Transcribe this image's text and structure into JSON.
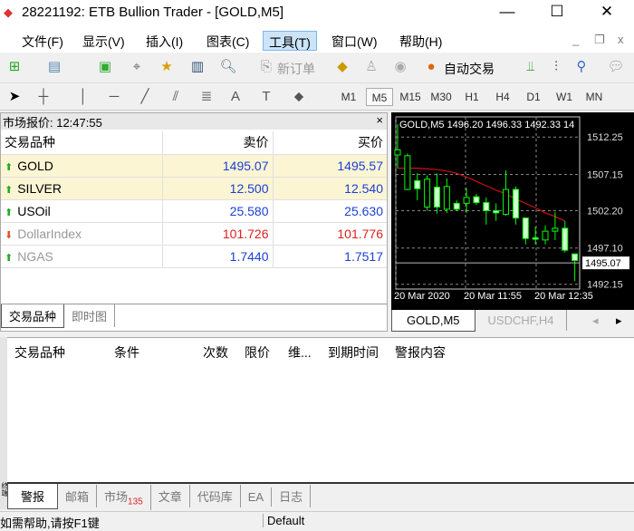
{
  "window": {
    "title": "28221192: ETB Bullion Trader - [GOLD,M5]",
    "minimize": "—",
    "maximize": "☐",
    "close": "✕"
  },
  "menu": [
    "文件(F)",
    "显示(V)",
    "插入(I)",
    "图表(C)",
    "工具(T)",
    "窗口(W)",
    "帮助(H)"
  ],
  "toolbar": {
    "new_order": "新订单",
    "auto_trade": "自动交易"
  },
  "timeframes": [
    "M1",
    "M5",
    "M15",
    "M30",
    "H1",
    "H4",
    "D1",
    "W1",
    "MN"
  ],
  "market_watch": {
    "title": "市场报价: 12:47:55",
    "headers": [
      "交易品种",
      "卖价",
      "买价"
    ],
    "rows": [
      {
        "symbol": "GOLD",
        "bid": "1495.07",
        "ask": "1495.57",
        "dir": "up",
        "color": "#1a3fd6",
        "hl": true
      },
      {
        "symbol": "SILVER",
        "bid": "12.500",
        "ask": "12.540",
        "dir": "up",
        "color": "#1a3fd6",
        "hl": true
      },
      {
        "symbol": "USOil",
        "bid": "25.580",
        "ask": "25.630",
        "dir": "up",
        "color": "#1a3fd6",
        "hl": false
      },
      {
        "symbol": "DollarIndex",
        "bid": "101.726",
        "ask": "101.776",
        "dir": "down",
        "color": "#e02020",
        "hl": false
      },
      {
        "symbol": "NGAS",
        "bid": "1.7440",
        "ask": "1.7517",
        "dir": "up",
        "color": "#1a3fd6",
        "hl": false
      }
    ],
    "tabs": [
      "交易品种",
      "即时图"
    ]
  },
  "chart_data": {
    "type": "candlestick",
    "title": "GOLD,M5  1496.20 1496.33 1492.33 14",
    "y_ticks": [
      "1512.25",
      "1507.15",
      "1502.20",
      "1497.10",
      "1492.15"
    ],
    "ylim": [
      1491.5,
      1515
    ],
    "x_labels": [
      "20 Mar 2020",
      "20 Mar 11:55",
      "20 Mar 12:35"
    ],
    "current_price": "1495.07",
    "ohlc": [
      [
        1509.8,
        1514,
        1508,
        1510.5
      ],
      [
        1505.1,
        1510,
        1505,
        1509.7
      ],
      [
        1506.3,
        1507.3,
        1503.6,
        1505.2
      ],
      [
        1502.7,
        1507,
        1502.2,
        1506.5
      ],
      [
        1505.4,
        1507.3,
        1501.8,
        1502.7
      ],
      [
        1502.4,
        1506.6,
        1501.9,
        1505.5
      ],
      [
        1503.2,
        1503.6,
        1502.2,
        1502.4
      ],
      [
        1503.2,
        1505.3,
        1501.9,
        1504.0
      ],
      [
        1504.1,
        1504.5,
        1503,
        1503.3
      ],
      [
        1503.3,
        1504,
        1500.3,
        1502.2
      ],
      [
        1502.2,
        1503.2,
        1500.8,
        1501.9
      ],
      [
        1501.7,
        1507.7,
        1501.5,
        1505.1
      ],
      [
        1505.1,
        1505.5,
        1500.3,
        1501.2
      ],
      [
        1501.2,
        1501.2,
        1497.6,
        1498.4
      ],
      [
        1498.5,
        1500,
        1497.6,
        1498.3
      ],
      [
        1498.2,
        1500.2,
        1497.6,
        1499.4
      ],
      [
        1499.4,
        1502,
        1498.2,
        1499.8
      ],
      [
        1499.8,
        1500.8,
        1496.5,
        1496.8
      ],
      [
        1496.3,
        1496.3,
        1492.6,
        1495.4
      ]
    ],
    "ma": [
      1508.0,
      1508.0,
      1508.0,
      1507.9,
      1507.8,
      1507.6,
      1507.3,
      1506.8,
      1506.2,
      1505.6,
      1505.0,
      1504.5,
      1503.8,
      1503.2,
      1502.6,
      1501.9,
      1501.4,
      1500.8
    ],
    "colors": {
      "candle": "#00ff00",
      "ma": "#cc1111",
      "grid": "#888888"
    }
  },
  "chart_tabs": [
    "GOLD,M5",
    "USDCHF,H4"
  ],
  "alerts": {
    "headers": [
      "交易品种",
      "条件",
      "次数",
      "限价",
      "维...",
      "到期时间",
      "警报内容"
    ]
  },
  "bottom_tabs": [
    {
      "label": "警报"
    },
    {
      "label": "邮箱"
    },
    {
      "label": "市场",
      "badge": "135"
    },
    {
      "label": "文章"
    },
    {
      "label": "代码库"
    },
    {
      "label": "EA"
    },
    {
      "label": "日志"
    }
  ],
  "side_label": "终端",
  "status": {
    "help": "如需帮助,请按F1键",
    "profile": "Default"
  }
}
